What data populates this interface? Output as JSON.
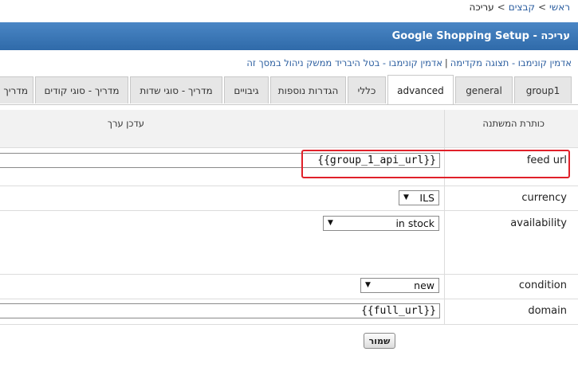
{
  "breadcrumb": {
    "items": [
      "ראשי",
      "קבצים",
      "עריכה"
    ],
    "separator": ">"
  },
  "title": "Google Shopping Setup - עריכה",
  "top_links": [
    "אדמין קונימבו - תצוגה מקדימה",
    "אדמין קונימבו - בטל היבריד ממשק ניהול במסך זה"
  ],
  "tabs": [
    {
      "label": "group1",
      "active": false
    },
    {
      "label": "general",
      "active": false
    },
    {
      "label": "advanced",
      "active": true
    },
    {
      "label": "כללי",
      "active": false
    },
    {
      "label": "הגדרות נוספות",
      "active": false
    },
    {
      "label": "גיבויים",
      "active": false
    },
    {
      "label": "מדריך - סוגי שדות",
      "active": false
    },
    {
      "label": "מדריך - סוגי קודים",
      "active": false
    },
    {
      "label": "מדריך",
      "active": false
    }
  ],
  "table": {
    "col_variable": "כותרת המשתנה",
    "col_value": "עדכן ערך"
  },
  "fields": {
    "feed_url": {
      "label": "feed url",
      "value": "{{group_1_api_url}}"
    },
    "currency": {
      "label": "currency",
      "value": "ILS"
    },
    "availability": {
      "label": "availability",
      "value": "in stock"
    },
    "condition": {
      "label": "condition",
      "value": "new"
    },
    "domain": {
      "label": "domain",
      "value": "{{full_url}}"
    }
  },
  "save_label": "שמור",
  "colors": {
    "title_bar": "#3a76b8",
    "highlight": "#e0212a",
    "link": "#2a5d9f"
  }
}
